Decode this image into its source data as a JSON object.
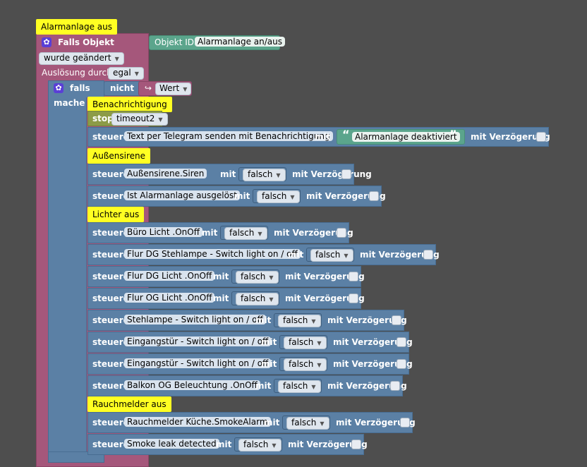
{
  "event_block": {
    "comment": "Alarmanlage aus",
    "falls_objekt": "Falls Objekt",
    "objekt_id_label": "Objekt ID",
    "objekt_id_value": "Alarmanlage an/aus",
    "wurde_geaendert": "wurde geändert",
    "ausloesung_label": "Auslösung durch",
    "ausloesung_value": "egal"
  },
  "if_block": {
    "falls": "falls",
    "mache": "mache",
    "nicht": "nicht",
    "wert": "Wert"
  },
  "common": {
    "steuere": "steuere",
    "mit": "mit",
    "verzoegerung": "mit Verzögerung",
    "falsch": "falsch",
    "stop": "stop"
  },
  "sections": {
    "benachrichtigung": "Benachrichtigung",
    "aussensirene": "Außensirene",
    "lichter": "Lichter aus",
    "rauchmelder": "Rauchmelder aus"
  },
  "timeout": "timeout2",
  "telegram": {
    "target": "Text per Telegram senden mit Benachrichtigung",
    "text": "Alarmanlage deaktiviert"
  },
  "controls": [
    {
      "target": "Außensirene.Siren"
    },
    {
      "target": "Ist Alarmanlage ausgelöst"
    },
    {
      "target": "Büro Licht .OnOff"
    },
    {
      "target": "Flur DG Stehlampe - Switch light on / off"
    },
    {
      "target": "Flur DG Licht .OnOff"
    },
    {
      "target": "Flur OG Licht .OnOff"
    },
    {
      "target": "Stehlampe - Switch light on / off"
    },
    {
      "target": "Eingangstür - Switch light on / off"
    },
    {
      "target": "Eingangstür - Switch light on / off"
    },
    {
      "target": "Balkon OG Beleuchtung .OnOff"
    },
    {
      "target": "Rauchmelder Küche.SmokeAlarm"
    },
    {
      "target": "Smoke leak detected"
    }
  ]
}
